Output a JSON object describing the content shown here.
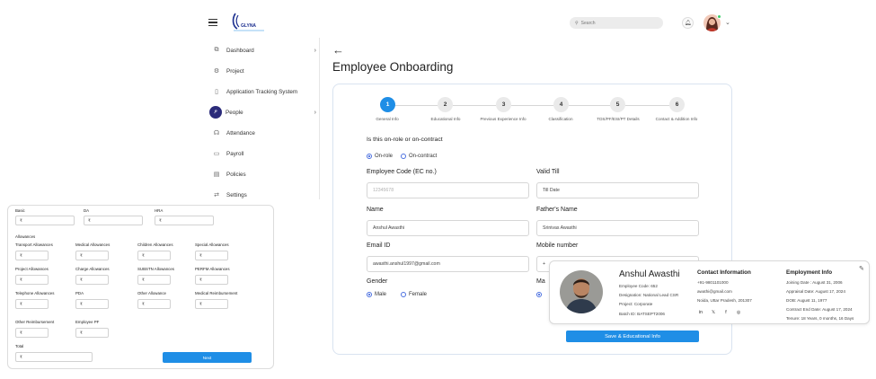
{
  "topbar": {
    "logo_text": "GLYNA",
    "search_placeholder": "Search",
    "colors": {
      "accent": "#1f8ee6",
      "nav_active": "#2b2b7a"
    }
  },
  "sidebar": {
    "items": [
      {
        "label": "Dashboard",
        "icon": "dashboard-icon",
        "chevron": true
      },
      {
        "label": "Project",
        "icon": "project-icon",
        "chevron": false
      },
      {
        "label": "Application Tracking System",
        "icon": "document-icon",
        "chevron": false
      },
      {
        "label": "People",
        "icon": "people-icon",
        "chevron": true,
        "active": true
      },
      {
        "label": "Attendance",
        "icon": "attendance-icon",
        "chevron": false
      },
      {
        "label": "Payroll",
        "icon": "payroll-icon",
        "chevron": false
      },
      {
        "label": "Policies",
        "icon": "policies-icon",
        "chevron": false
      },
      {
        "label": "Settings",
        "icon": "settings-icon",
        "chevron": false
      }
    ]
  },
  "main": {
    "title": "Employee Onboarding",
    "steps": [
      {
        "num": "1",
        "label": "General Info",
        "active": true
      },
      {
        "num": "2",
        "label": "Educational Info"
      },
      {
        "num": "3",
        "label": "Previous Experience Info"
      },
      {
        "num": "4",
        "label": "Classification"
      },
      {
        "num": "5",
        "label": "TDS/PF/ESI/PT Details"
      },
      {
        "num": "6",
        "label": "Contact & Addition Info"
      }
    ],
    "role_question": "Is this on-role or on-contract",
    "role_options": [
      "On-role",
      "On-contract"
    ],
    "employee_code_label": "Employee Code (EC no.)",
    "employee_code_value": "12345678",
    "valid_till_label": "Valid Till",
    "valid_till_placeholder": "Till Date",
    "name_label": "Name",
    "name_value": "Anshul Awasthi",
    "father_label": "Father's Name",
    "father_value": "Srinivas Awasthi",
    "email_label": "Email ID",
    "email_value": "awasthi.anshul1997@gmail.com",
    "mobile_label": "Mobile number",
    "mobile_prefix": "+",
    "gender_label": "Gender",
    "gender_options": [
      "Male",
      "Female"
    ],
    "marital_label": "Ma",
    "save_button": "Save & Educational Info"
  },
  "profile": {
    "name": "Anshul Awasthi",
    "employee_code": "Employee Code: 652",
    "designation": "Designation: National Lead CSR",
    "project": "Project: Corporate",
    "batch": "Batch ID: BATSEPT2006",
    "contact_head": "Contact Information",
    "phone": "+91-9801101000",
    "email": "awathi@gmail.com",
    "location": "Noida, Uttar Pradesh, 201307",
    "employment_head": "Employment Info",
    "joining": "Joining Date : August 31, 2006",
    "appraisal": "Appraisal Date: August 17, 2024",
    "dob": "DOB: August 11, 1977",
    "contract_end": "Contract End Date: August 17, 2024",
    "tenure": "Tenure: 18 Years, 0 months, 16 Days",
    "social_icons": [
      "linkedin-icon",
      "twitter-icon",
      "facebook-icon",
      "instagram-icon"
    ],
    "social_glyphs": [
      "in",
      "𝕏",
      "f",
      "◎"
    ]
  },
  "salary": {
    "basic": "Basic",
    "da": "DA",
    "hra": "HRA",
    "currency": "₹",
    "allowances_head": "Allowances",
    "row1": [
      "Transport Allowances",
      "Medical Allowances",
      "Children Allowances",
      "Special Allowances"
    ],
    "row2": [
      "Project Allowances",
      "Charge Allowances",
      "SUBSTN Allowances",
      "PERFM Allowances"
    ],
    "row3": [
      "Telephone Allowances",
      "PDA",
      "Other Allowance",
      "Medical Reimbursement"
    ],
    "row4": [
      "Other Reimbursement",
      "Employee PF"
    ],
    "total": "Total",
    "next_button": "Next"
  }
}
